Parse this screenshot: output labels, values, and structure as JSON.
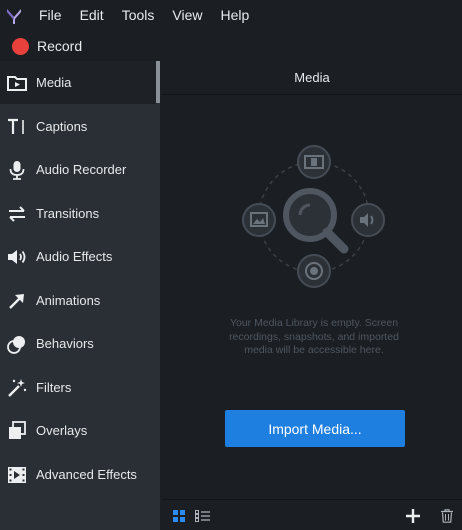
{
  "menu": {
    "items": [
      {
        "label": "File"
      },
      {
        "label": "Edit"
      },
      {
        "label": "Tools"
      },
      {
        "label": "View"
      },
      {
        "label": "Help"
      }
    ]
  },
  "record": {
    "label": "Record"
  },
  "sidebar": {
    "items": [
      {
        "label": "Media",
        "icon": "media-icon",
        "active": true
      },
      {
        "label": "Captions",
        "icon": "captions-icon"
      },
      {
        "label": "Audio Recorder",
        "icon": "microphone-icon"
      },
      {
        "label": "Transitions",
        "icon": "transitions-icon"
      },
      {
        "label": "Audio Effects",
        "icon": "speaker-icon"
      },
      {
        "label": "Animations",
        "icon": "arrow-icon"
      },
      {
        "label": "Behaviors",
        "icon": "behaviors-icon"
      },
      {
        "label": "Filters",
        "icon": "magic-wand-icon"
      },
      {
        "label": "Overlays",
        "icon": "overlays-icon"
      },
      {
        "label": "Advanced Effects",
        "icon": "film-icon"
      }
    ]
  },
  "main": {
    "title": "Media",
    "empty_message": "Your Media Library is empty. Screen recordings, snapshots, and imported media will be accessible here.",
    "import_label": "Import Media..."
  },
  "footer": {
    "icons": [
      "grid-view-icon",
      "list-view-icon",
      "add-icon",
      "trash-icon"
    ]
  },
  "colors": {
    "accent": "#1f7fe0",
    "record": "#e8413c",
    "sidebar_bg": "#2a2f35",
    "main_bg": "#1b1f23"
  }
}
